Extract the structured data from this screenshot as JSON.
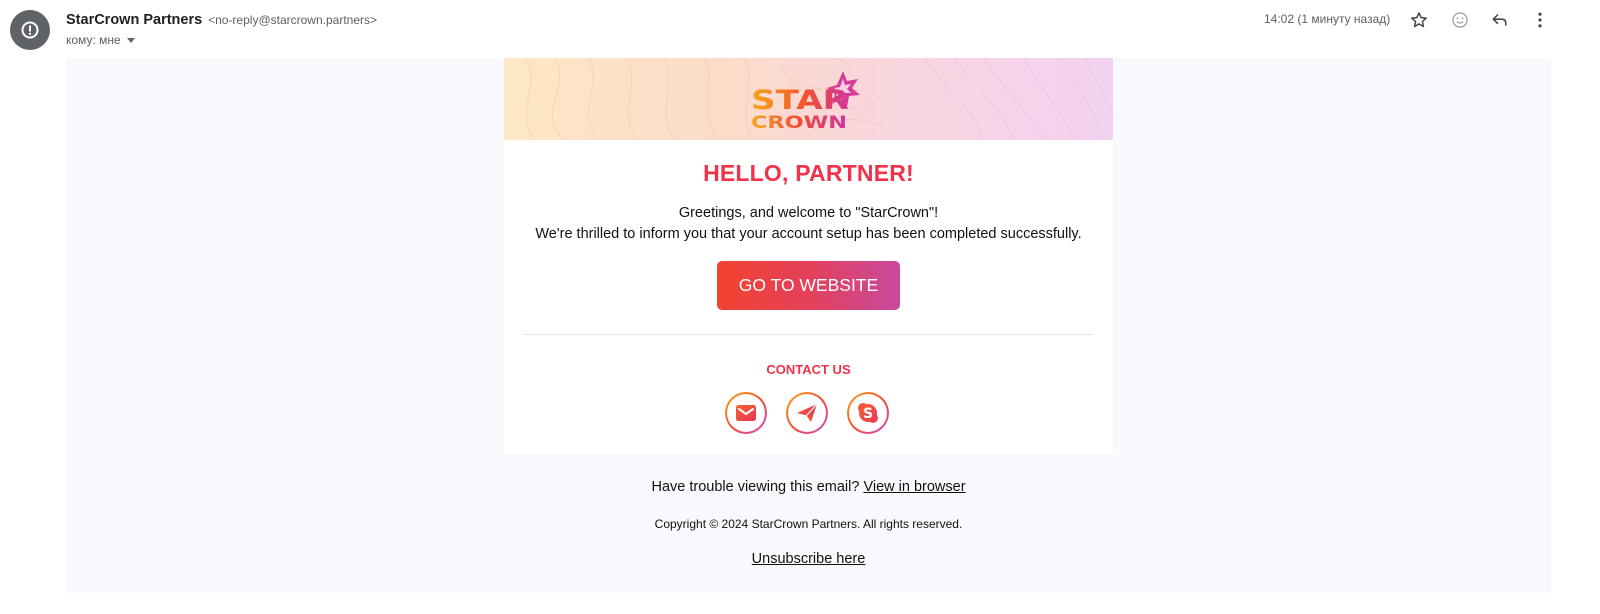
{
  "header": {
    "avatar_icon": "warning-circle-icon",
    "sender_name": "StarCrown Partners",
    "sender_email": "<no-reply@starcrown.partners>",
    "recipient_label": "кому: мне",
    "timestamp": "14:02 (1 минуту назад)",
    "actions": [
      {
        "name": "star",
        "icon": "star-icon"
      },
      {
        "name": "emoji-reaction",
        "icon": "emoji-icon"
      },
      {
        "name": "reply",
        "icon": "reply-icon"
      },
      {
        "name": "more-options",
        "icon": "more-vertical-icon"
      }
    ]
  },
  "email": {
    "logo": {
      "line1": "STAR",
      "line2": "CROWN"
    },
    "title": "HELLO, PARTNER!",
    "body_lines": [
      "Greetings, and welcome to \"StarCrown\"!",
      "We're thrilled to inform you that your account setup has been completed successfully."
    ],
    "cta_label": "GO TO WEBSITE",
    "contact_title": "CONTACT US",
    "socials": [
      {
        "name": "email",
        "icon": "mail-icon"
      },
      {
        "name": "telegram",
        "icon": "telegram-icon"
      },
      {
        "name": "skype",
        "icon": "skype-icon"
      }
    ],
    "footer": {
      "trouble_text": "Have trouble viewing this email?",
      "view_in_browser": "View in browser",
      "copyright": "Copyright © 2024 StarCrown Partners. All rights reserved.",
      "unsubscribe": "Unsubscribe here"
    }
  },
  "colors": {
    "accent_red": "#f0334a",
    "button_gradient_start": "#f2432f",
    "button_gradient_end": "#c84a9e",
    "canvas_bg": "#f8f9fd"
  }
}
